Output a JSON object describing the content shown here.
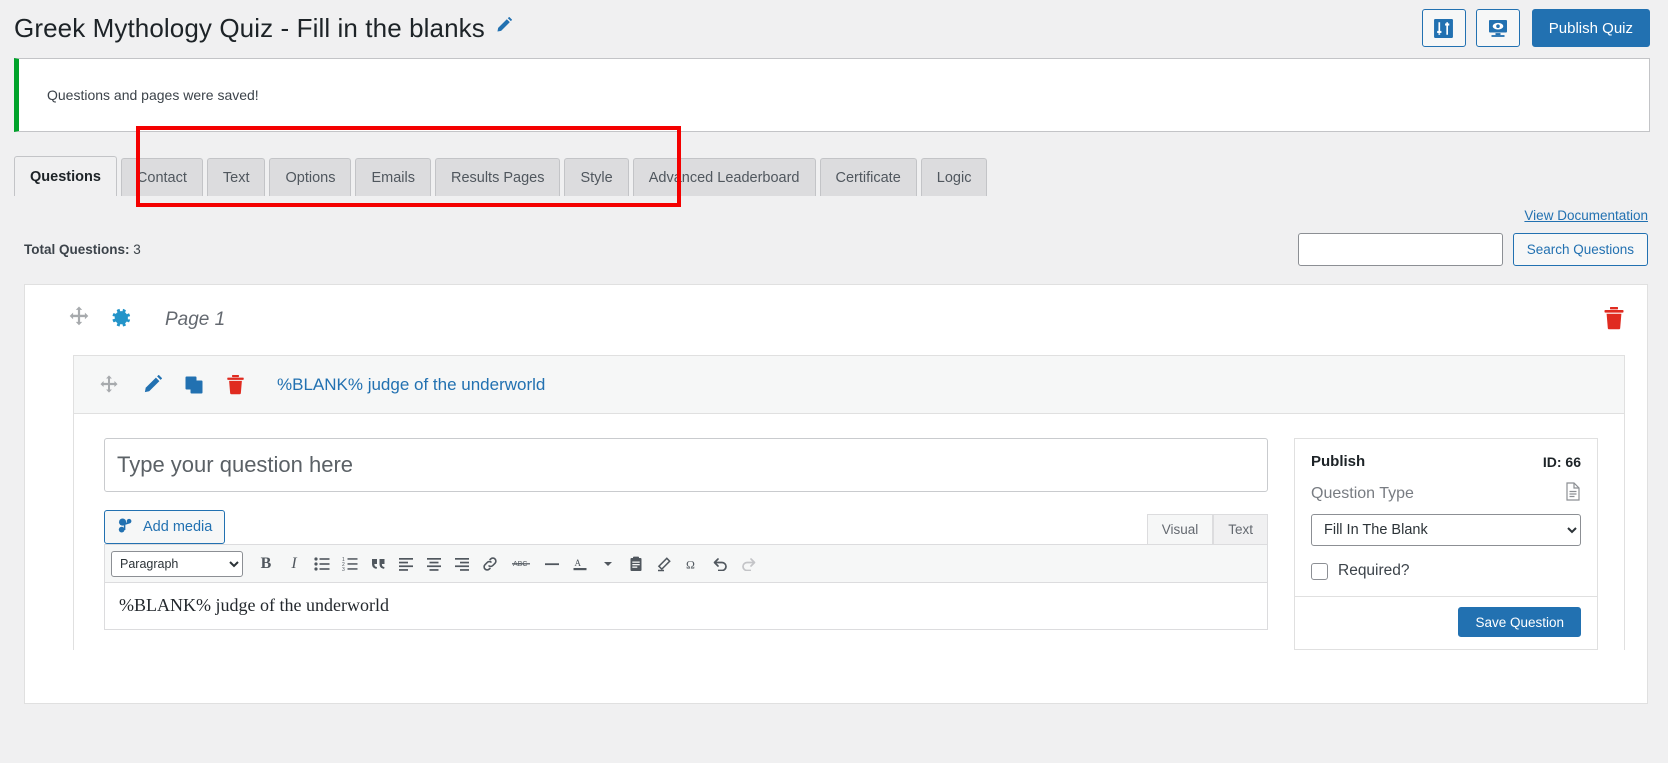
{
  "header": {
    "quiz_title": "Greek Mythology Quiz - Fill in the blanks",
    "edit_icon": "pencil-icon",
    "settings_icon": "sliders-icon",
    "preview_icon": "preview-monitor-icon",
    "publish_label": "Publish Quiz",
    "accent_color": "#2271b1"
  },
  "notice": {
    "message": "Questions and pages were saved!",
    "accent_color": "#00a32a"
  },
  "tabs": {
    "items": [
      {
        "label": "Questions",
        "active": true
      },
      {
        "label": "Contact",
        "active": false
      },
      {
        "label": "Text",
        "active": false
      },
      {
        "label": "Options",
        "active": false
      },
      {
        "label": "Emails",
        "active": false
      },
      {
        "label": "Results Pages",
        "active": false
      },
      {
        "label": "Style",
        "active": false
      },
      {
        "label": "Advanced Leaderboard",
        "active": false
      },
      {
        "label": "Certificate",
        "active": false
      },
      {
        "label": "Logic",
        "active": false
      }
    ],
    "highlight_color": "#f40000"
  },
  "toolbar": {
    "documentation_link": "View Documentation",
    "total_questions_label": "Total Questions:",
    "total_questions_value": "3",
    "search_value": "",
    "search_placeholder": "",
    "search_button": "Search Questions"
  },
  "page": {
    "label": "Page 1",
    "move_icon": "move-arrows-icon",
    "gear_icon": "gear-icon",
    "delete_icon": "trash-icon"
  },
  "question": {
    "title": "%BLANK% judge of the underworld",
    "row_icons": [
      "move-arrows-icon",
      "pencil-icon",
      "duplicate-icon",
      "trash-icon"
    ],
    "input_value": "",
    "input_placeholder": "Type your question here",
    "add_media_label": "Add media",
    "editor_tabs": [
      {
        "label": "Visual",
        "active": true
      },
      {
        "label": "Text",
        "active": false
      }
    ],
    "format_select": "Paragraph",
    "editor_content": "%BLANK% judge of the underworld",
    "toolbar_buttons": [
      "bold-icon",
      "italic-icon",
      "bulleted-list-icon",
      "numbered-list-icon",
      "blockquote-icon",
      "align-left-icon",
      "align-center-icon",
      "align-right-icon",
      "link-icon",
      "strikethrough-icon",
      "horizontal-rule-icon",
      "text-color-icon",
      "chevron-down-icon",
      "paste-as-text-icon",
      "clear-formatting-icon",
      "special-character-icon",
      "undo-icon",
      "redo-icon"
    ]
  },
  "publish_panel": {
    "title": "Publish",
    "id_label": "ID: 66",
    "document_icon": "document-icon",
    "question_type_label": "Question Type",
    "question_type_value": "Fill In The Blank",
    "question_type_options": [
      "Fill In The Blank"
    ],
    "required_label": "Required?",
    "required_checked": false,
    "save_label": "Save Question"
  }
}
